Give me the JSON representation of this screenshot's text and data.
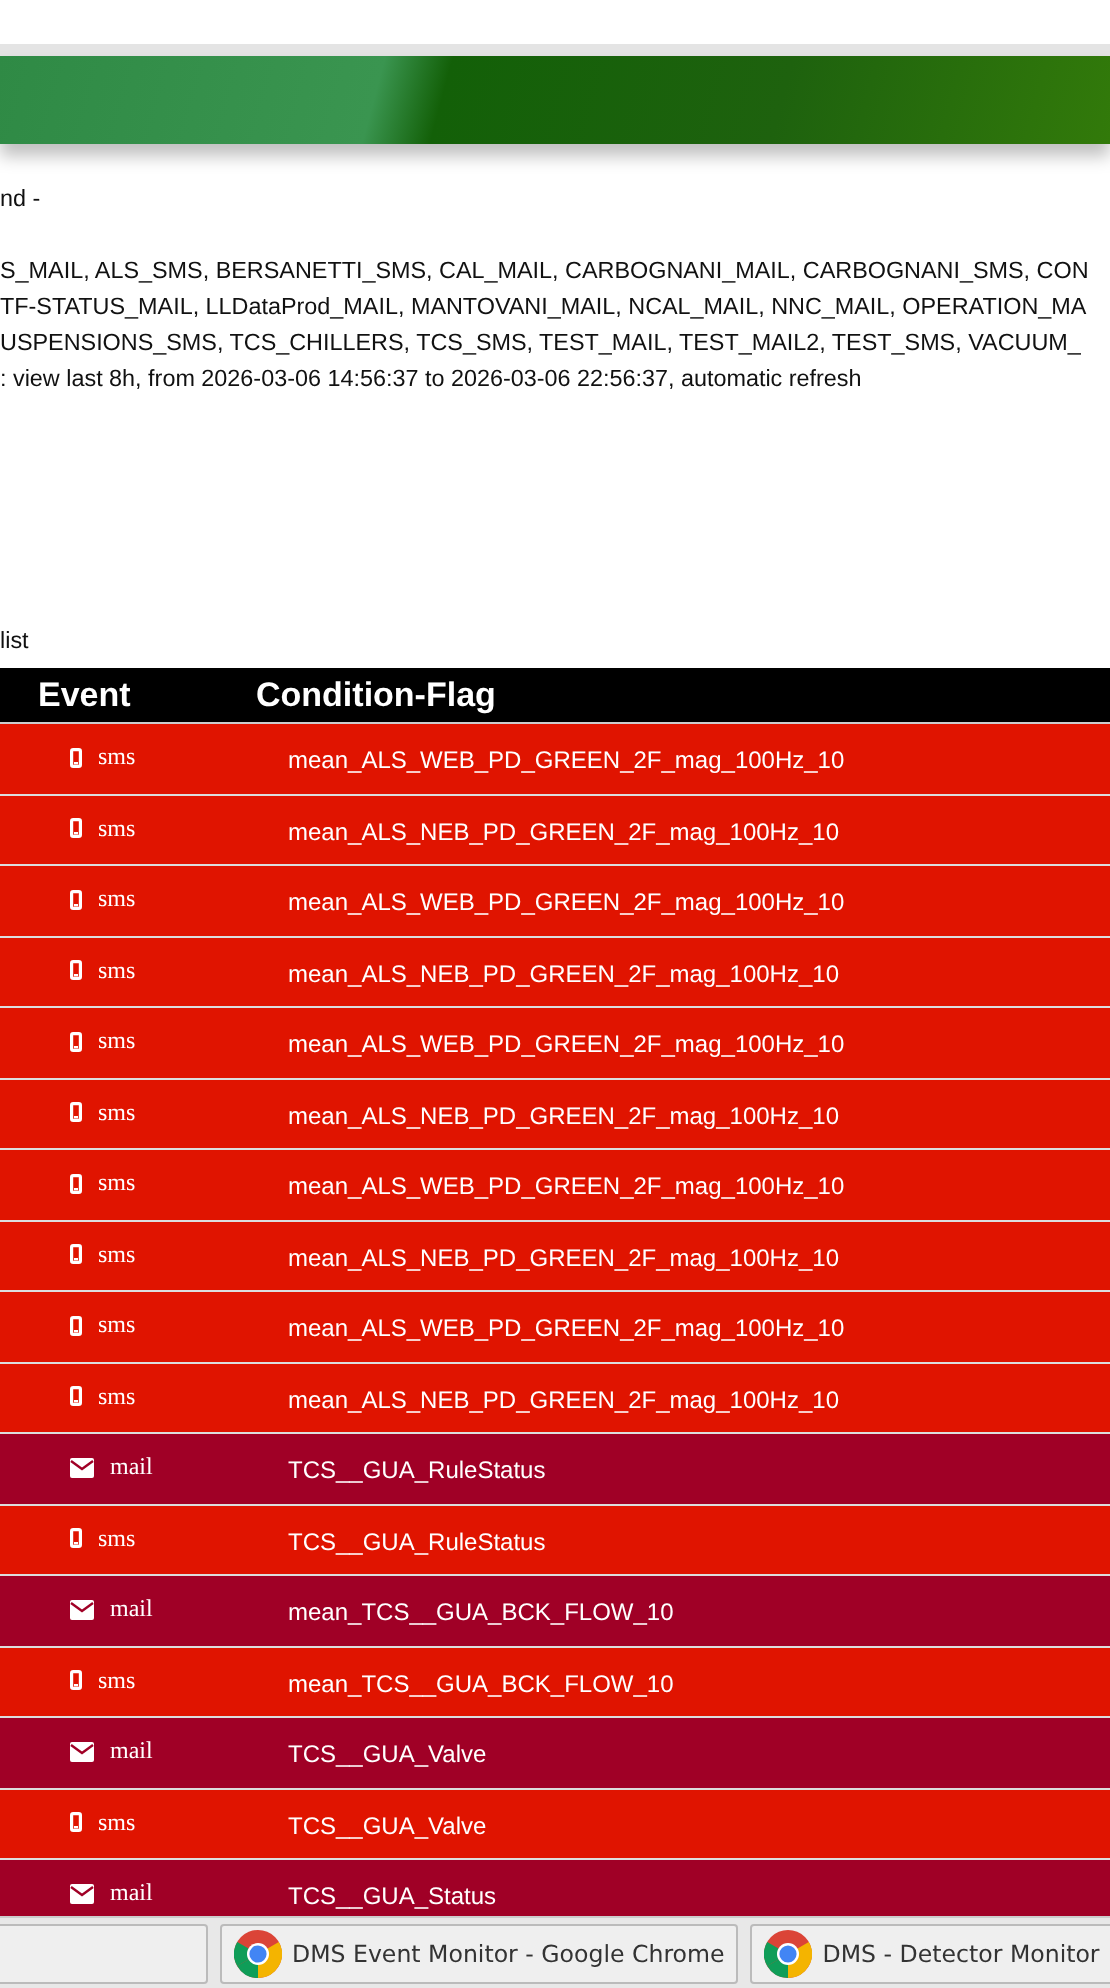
{
  "header_lines": [
    "nd -"
  ],
  "info_lines": [
    "S_MAIL, ALS_SMS, BERSANETTI_SMS, CAL_MAIL, CARBOGNANI_MAIL, CARBOGNANI_SMS, CON",
    "TF-STATUS_MAIL, LLDataProd_MAIL, MANTOVANI_MAIL, NCAL_MAIL, NNC_MAIL, OPERATION_MA",
    "USPENSIONS_SMS, TCS_CHILLERS, TCS_SMS, TEST_MAIL, TEST_MAIL2, TEST_SMS, VACUUM_",
    ": view last 8h, from 2026-03-06 14:56:37 to 2026-03-06 22:56:37, automatic refresh"
  ],
  "list_label": "list",
  "table": {
    "columns": [
      "Event",
      "Condition-Flag"
    ],
    "rows": [
      {
        "kind": "sms",
        "event": "sms",
        "flag": "mean_ALS_WEB_PD_GREEN_2F_mag_100Hz_10"
      },
      {
        "kind": "sms",
        "event": "sms",
        "flag": "mean_ALS_NEB_PD_GREEN_2F_mag_100Hz_10"
      },
      {
        "kind": "sms",
        "event": "sms",
        "flag": "mean_ALS_WEB_PD_GREEN_2F_mag_100Hz_10"
      },
      {
        "kind": "sms",
        "event": "sms",
        "flag": "mean_ALS_NEB_PD_GREEN_2F_mag_100Hz_10"
      },
      {
        "kind": "sms",
        "event": "sms",
        "flag": "mean_ALS_WEB_PD_GREEN_2F_mag_100Hz_10"
      },
      {
        "kind": "sms",
        "event": "sms",
        "flag": "mean_ALS_NEB_PD_GREEN_2F_mag_100Hz_10"
      },
      {
        "kind": "sms",
        "event": "sms",
        "flag": "mean_ALS_WEB_PD_GREEN_2F_mag_100Hz_10"
      },
      {
        "kind": "sms",
        "event": "sms",
        "flag": "mean_ALS_NEB_PD_GREEN_2F_mag_100Hz_10"
      },
      {
        "kind": "sms",
        "event": "sms",
        "flag": "mean_ALS_WEB_PD_GREEN_2F_mag_100Hz_10"
      },
      {
        "kind": "sms",
        "event": "sms",
        "flag": "mean_ALS_NEB_PD_GREEN_2F_mag_100Hz_10"
      },
      {
        "kind": "mail",
        "event": "mail",
        "flag": "TCS__GUA_RuleStatus"
      },
      {
        "kind": "sms",
        "event": "sms",
        "flag": "TCS__GUA_RuleStatus"
      },
      {
        "kind": "mail",
        "event": "mail",
        "flag": "mean_TCS__GUA_BCK_FLOW_10"
      },
      {
        "kind": "sms",
        "event": "sms",
        "flag": "mean_TCS__GUA_BCK_FLOW_10"
      },
      {
        "kind": "mail",
        "event": "mail",
        "flag": "TCS__GUA_Valve"
      },
      {
        "kind": "sms",
        "event": "sms",
        "flag": "TCS__GUA_Valve"
      },
      {
        "kind": "mail",
        "event": "mail",
        "flag": "TCS__GUA_Status"
      }
    ]
  },
  "taskbar": {
    "items": [
      {
        "label": "DMS Event Monitor - Google Chrome"
      },
      {
        "label": "DMS - Detector Monitor"
      }
    ]
  }
}
